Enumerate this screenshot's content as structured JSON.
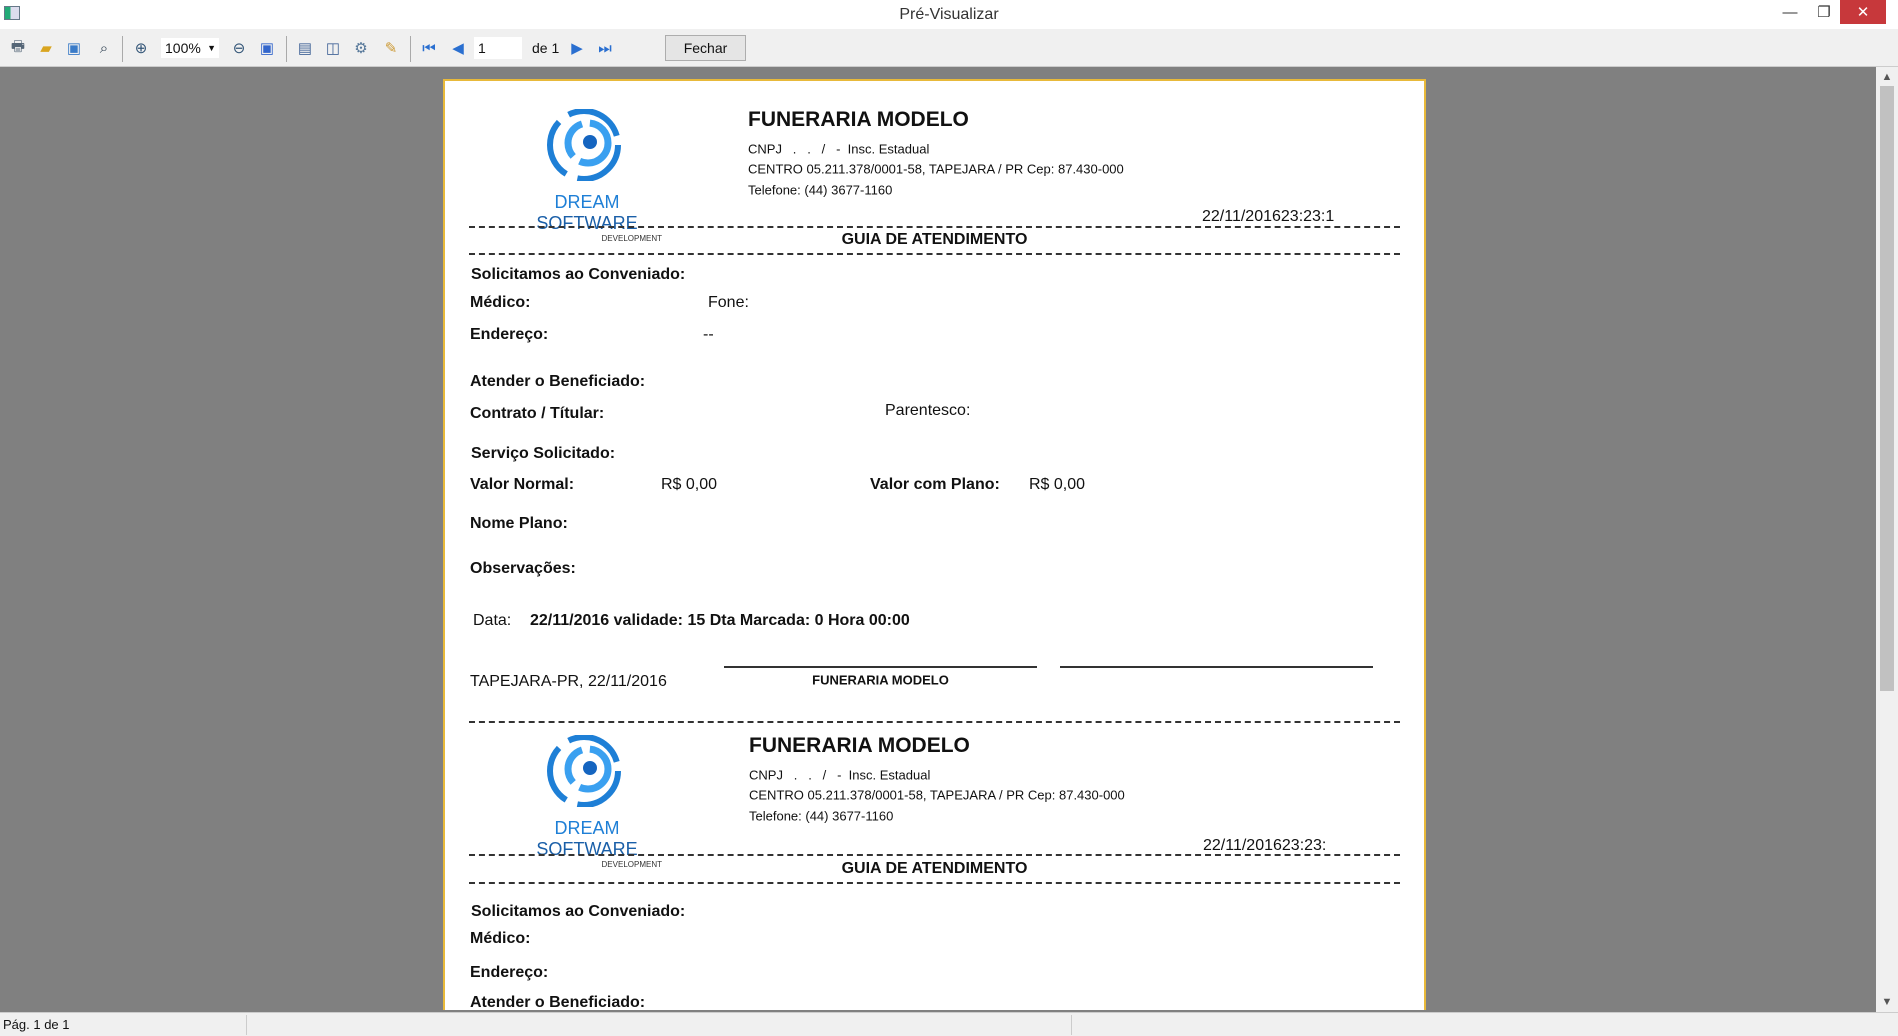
{
  "window": {
    "title": "Pré-Visualizar",
    "minimize": "—",
    "maximize": "❐",
    "close": "✕"
  },
  "toolbar": {
    "zoom": "100%",
    "page_input": "1",
    "of_label": "de 1",
    "close_label": "Fechar",
    "icons": [
      "print-icon",
      "open-icon",
      "save-icon",
      "find-icon",
      "zoom-in-icon",
      "zoom-out-icon",
      "full-page-icon",
      "single-page-icon",
      "two-pages-icon",
      "page-setup-icon",
      "edit-icon",
      "first-page-icon",
      "prev-page-icon",
      "next-page-icon",
      "last-page-icon"
    ]
  },
  "logo": {
    "name": "DREAM",
    "name2": "SOFTWARE",
    "sub": "DEVELOPMENT"
  },
  "copies": [
    {
      "company": "FUNERARIA MODELO",
      "cnpj": "CNPJ   .   .   /   -  Insc. Estadual",
      "address": "CENTRO 05.211.378/0001-58, TAPEJARA / PR Cep: 87.430-000",
      "phone": "Telefone: (44) 3677-1160",
      "datetime": "22/11/201623:23:1",
      "heading": "GUIA DE ATENDIMENTO"
    },
    {
      "company": "FUNERARIA MODELO",
      "cnpj": "CNPJ   .   .   /   -  Insc. Estadual",
      "address": "CENTRO 05.211.378/0001-58, TAPEJARA / PR Cep: 87.430-000",
      "phone": "Telefone: (44) 3677-1160",
      "datetime": "22/11/201623:23:",
      "heading": "GUIA DE ATENDIMENTO"
    }
  ],
  "form": {
    "solicitamos": "Solicitamos ao Conveniado:",
    "medico": "Médico:",
    "fone": "Fone:",
    "endereco": "Endereço:",
    "endereco_value": "--",
    "atender": "Atender o Beneficiado:",
    "contrato": "Contrato / Títular:",
    "parentesco": "Parentesco:",
    "servico": "Serviço Solicitado:",
    "valor_normal": "Valor Normal:",
    "valor_normal_value": "R$ 0,00",
    "valor_plano": "Valor com Plano:",
    "valor_plano_value": "R$ 0,00",
    "nome_plano": "Nome Plano:",
    "observacoes": "Observações:",
    "data_label": "Data:",
    "data_value": "22/11/2016 validade: 15 Dta Marcada: 0 Hora 00:00",
    "local_date": "TAPEJARA-PR, 22/11/2016",
    "signature": "FUNERARIA MODELO",
    "atender_partial": "Atender o Beneficiado:"
  },
  "status": {
    "page": "Pág. 1 de 1"
  }
}
